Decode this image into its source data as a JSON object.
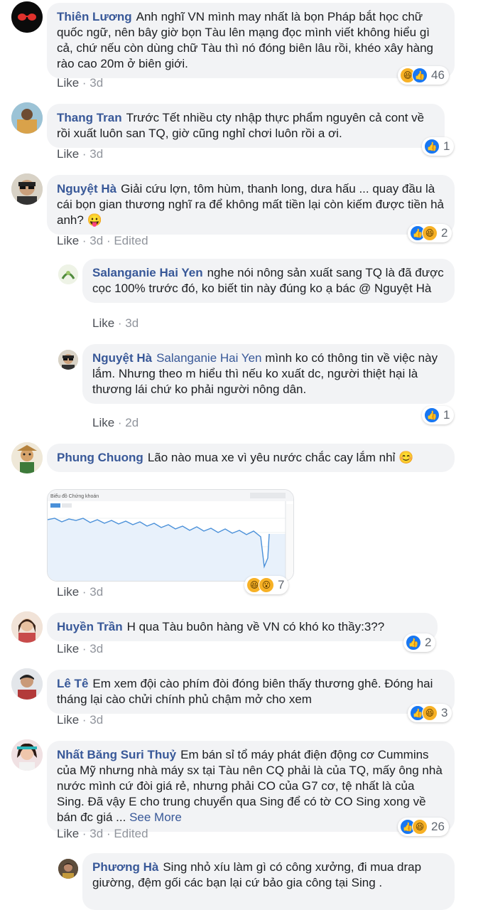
{
  "comments": [
    {
      "author": "Thiên Lương",
      "text": "Anh nghĩ VN mình may nhất là bọn Pháp bắt học chữ quốc ngữ, nên bây giờ bọn Tàu lên mạng đọc mình viết không hiểu gì cả, chứ nếu còn dùng chữ Tàu thì nó đóng biên lâu rồi, khéo xây hàng rào cao 20m ở biên giới.",
      "like": "Like",
      "time": "3d",
      "reactions": [
        "haha",
        "like"
      ],
      "count": "46"
    },
    {
      "author": "Thang Tran",
      "text": "Trước Tết nhiều cty nhập thực phẩm nguyên cả cont về rồi xuất luôn san TQ, giờ cũng nghỉ chơi luôn rồi a ơi.",
      "like": "Like",
      "time": "3d",
      "reactions": [
        "like"
      ],
      "count": "1"
    },
    {
      "author": "Nguyệt Hà",
      "text": "Giải cứu lợn, tôm hùm, thanh long, dưa hấu ... quay đầu là cái bọn gian thương nghĩ ra để không mất tiền lại còn kiếm được tiền hả anh? 😛",
      "like": "Like",
      "time": "3d",
      "edited": "Edited",
      "reactions": [
        "like",
        "haha"
      ],
      "count": "2"
    },
    {
      "author": "Salanganie Hai Yen",
      "text": "nghe nói nông sản xuất sang TQ là đã được cọc 100% trước đó, ko biết tin này đúng ko ạ bác @ Nguyệt Hà",
      "like": "Like",
      "time": "3d"
    },
    {
      "author": "Nguyệt Hà",
      "mention": "Salanganie Hai Yen",
      "text": "mình ko có thông tin về việc này lắm. Nhưng theo m hiểu thì nếu ko xuất dc, người thiệt hại là thương lái chứ ko phải người nông dân.",
      "like": "Like",
      "time": "2d",
      "reactions": [
        "like"
      ],
      "count": "1"
    },
    {
      "author": "Phung Chuong",
      "text": "Lão nào mua xe vì yêu nước chắc cay lắm nhỉ 😊",
      "like": "Like",
      "time": "3d",
      "reactions": [
        "haha",
        "wow"
      ],
      "count": "7",
      "image_title": "Biểu đồ Chứng khoán"
    },
    {
      "author": "Huyền Trần",
      "text": "H qua Tàu buôn hàng về VN có khó ko thầy:3??",
      "like": "Like",
      "time": "3d",
      "reactions": [
        "like"
      ],
      "count": "2"
    },
    {
      "author": "Lê Tê",
      "text": "Em xem đội cào phím đòi đóng biên thấy thương ghê. Đóng hai tháng lại cào chửi chính phủ chậm mở cho xem",
      "like": "Like",
      "time": "3d",
      "reactions": [
        "like",
        "haha"
      ],
      "count": "3"
    },
    {
      "author": "Nhất Băng Suri Thuỷ",
      "text": "Em bán sỉ tổ máy phát điện động cơ Cummins của Mỹ nhưng nhà máy sx tại Tàu nên CQ phải là của TQ, mấy ông nhà nước mình cứ đòi giá rẻ, nhưng phải CO của G7 cơ, tệ nhất là của Sing. Đã vậy E cho trung chuyển qua Sing để có tờ CO Sing xong về bán đc giá ...",
      "see_more": "See More",
      "like": "Like",
      "time": "3d",
      "edited": "Edited",
      "reactions": [
        "like",
        "haha"
      ],
      "count": "26"
    },
    {
      "author": "Phương Hà",
      "text": "Sing nhỏ xíu làm gì có công xưởng, đi mua drap giường, đệm gối các bạn lại cứ bảo gia công tại Sing ."
    }
  ],
  "separator": " · ",
  "icons": {
    "like": "thumbs-up-icon",
    "haha": "laughing-face-icon",
    "wow": "surprised-face-icon"
  },
  "colors": {
    "author": "#385898",
    "bubble": "#f2f3f5",
    "meta": "#90949c",
    "like_reaction": "#1877f2",
    "haha_reaction": "#f7b125"
  }
}
